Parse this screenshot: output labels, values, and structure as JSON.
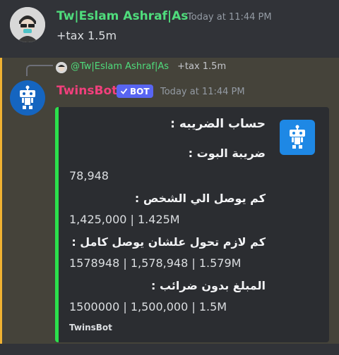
{
  "message1": {
    "author": "Tw|Eslam Ashraf|As",
    "timestamp": "Today at 11:44 PM",
    "content": "+tax 1.5m"
  },
  "message2": {
    "reply": {
      "author": "@Tw|Eslam Ashraf|As",
      "content": "+tax 1.5m"
    },
    "author": "TwinsBot",
    "badge": "BOT",
    "timestamp": "Today at 11:44 PM",
    "embed": {
      "title": "حساب الضريبه :",
      "fields": [
        {
          "name": "ضريبة البوت :",
          "value": "78,948"
        },
        {
          "name": "كم يوصل الي الشخص :",
          "value": "1,425,000 | 1.425M"
        },
        {
          "name": "كم لازم تحول علشان يوصل كامل :",
          "value": "1578948 | 1,578,948 | 1.579M"
        },
        {
          "name": "المبلغ بدون ضرائب :",
          "value": "1500000 | 1,500,000 | 1.5M"
        }
      ],
      "footer": "TwinsBot",
      "accent_color": "#2be04c"
    }
  },
  "icons": {
    "user_avatar": "anime-character-avatar",
    "bot_avatar": "robot-icon",
    "verified": "checkmark-icon"
  }
}
